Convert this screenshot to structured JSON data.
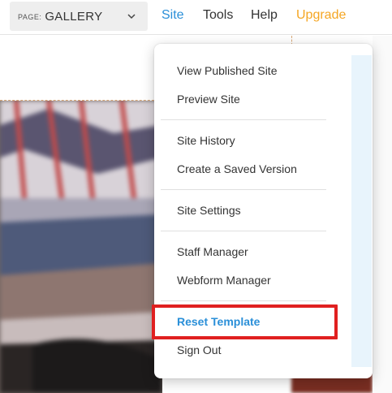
{
  "topbar": {
    "page_prefix": "PAGE:",
    "page_value": "GALLERY",
    "nav": {
      "site": "Site",
      "tools": "Tools",
      "help": "Help",
      "upgrade": "Upgrade"
    }
  },
  "site_menu": {
    "view_published_site": "View Published Site",
    "preview_site": "Preview Site",
    "site_history": "Site History",
    "create_saved_version": "Create a Saved Version",
    "site_settings": "Site Settings",
    "staff_manager": "Staff Manager",
    "webform_manager": "Webform Manager",
    "reset_template": "Reset Template",
    "sign_out": "Sign Out"
  },
  "colors": {
    "accent_blue": "#2a8fd8",
    "upgrade_orange": "#f5a623",
    "highlight_red": "#e02020"
  }
}
